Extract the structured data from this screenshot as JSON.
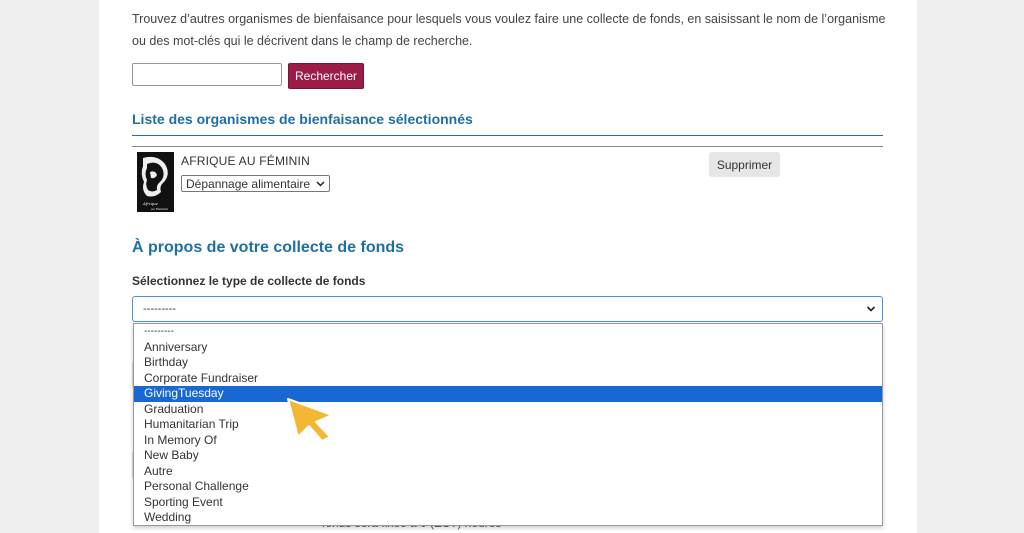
{
  "intro_text": "Trouvez d’autres organismes de bienfaisance pour lesquels vous voulez faire une collecte de fonds, en saisissant le nom de l’organisme ou des mot-clés qui le décrivent dans le champ de recherche.",
  "search": {
    "value": "",
    "button_label": "Rechercher"
  },
  "selected_list": {
    "title": "Liste des organismes de bienfaisance sélectionnés",
    "items": [
      {
        "name": "AFRIQUE AU FÉMININ",
        "category": "Dépannage alimentaire",
        "remove_label": "Supprimer",
        "logo_text": "Afrique au Féminin"
      }
    ]
  },
  "about": {
    "title": "À propos de votre collecte de fonds",
    "type_label": "Sélectionnez le type de collecte de fonds",
    "type_value": "---------",
    "options": [
      "---------",
      "Anniversary",
      "Birthday",
      "Corporate Fundraiser",
      "GivingTuesday",
      "Graduation",
      "Humanitarian Trip",
      "In Memory Of",
      "New Baby",
      "Autre",
      "Personal Challenge",
      "Sporting Event",
      "Wedding"
    ],
    "highlighted_option": "GivingTuesday"
  },
  "partial_text": "fonds sera fixée à 0 (EST) heures",
  "colors": {
    "accent": "#9b1c47",
    "heading": "#1f6fa3",
    "highlight": "#1967d2",
    "cursor": "#f4b733"
  }
}
